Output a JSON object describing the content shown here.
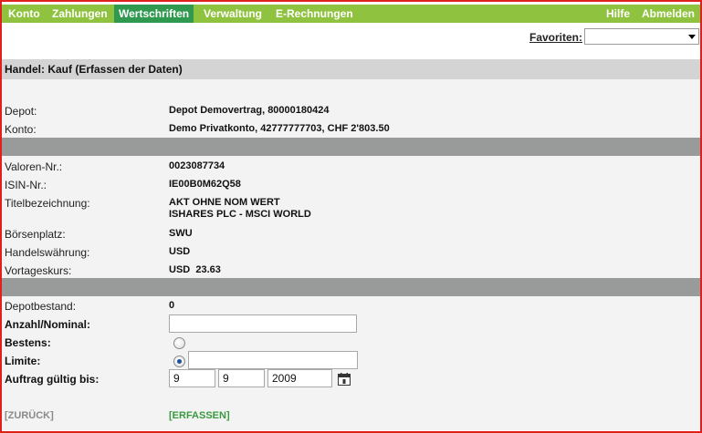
{
  "nav": {
    "items": [
      "Konto",
      "Zahlungen",
      "Wertschriften",
      "Verwaltung",
      "E-Rechnungen"
    ],
    "active": "Wertschriften",
    "right": [
      "Hilfe",
      "Abmelden"
    ]
  },
  "favorites": {
    "label": "Favoriten:",
    "selected": ""
  },
  "section": {
    "title": "Handel: Kauf (Erfassen der Daten)"
  },
  "account": {
    "depot_label": "Depot:",
    "depot_value": "Depot Demovertrag, 80000180424",
    "konto_label": "Konto:",
    "konto_value": "Demo Privatkonto, 42777777703, CHF 2'803.50"
  },
  "security": {
    "valoren_label": "Valoren-Nr.:",
    "valoren_value": "0023087734",
    "isin_label": "ISIN-Nr.:",
    "isin_value": "IE00B0M62Q58",
    "title_label": "Titelbezeichnung:",
    "title_line1": "AKT OHNE NOM WERT",
    "title_line2": "ISHARES PLC - MSCI WORLD",
    "exchange_label": "Börsenplatz:",
    "exchange_value": "SWU",
    "currency_label": "Handelswährung:",
    "currency_value": "USD",
    "price_label": "Vortageskurs:",
    "price_value": "USD  23.63"
  },
  "order": {
    "holding_label": "Depotbestand:",
    "holding_value": "0",
    "quantity_label": "Anzahl/Nominal:",
    "quantity_value": "",
    "market_label": "Bestens:",
    "market_selected": false,
    "limit_label": "Limite:",
    "limit_selected": true,
    "limit_value": "",
    "valid_label": "Auftrag gültig bis:",
    "valid_day": "9",
    "valid_month": "9",
    "valid_year": "2009"
  },
  "actions": {
    "back": "[ZURÜCK]",
    "submit": "[ERFASSEN]"
  },
  "colors": {
    "nav": "#8fc33f",
    "nav_active": "#2f9a4f",
    "divider": "#999a9a",
    "border": "#e0201c"
  }
}
